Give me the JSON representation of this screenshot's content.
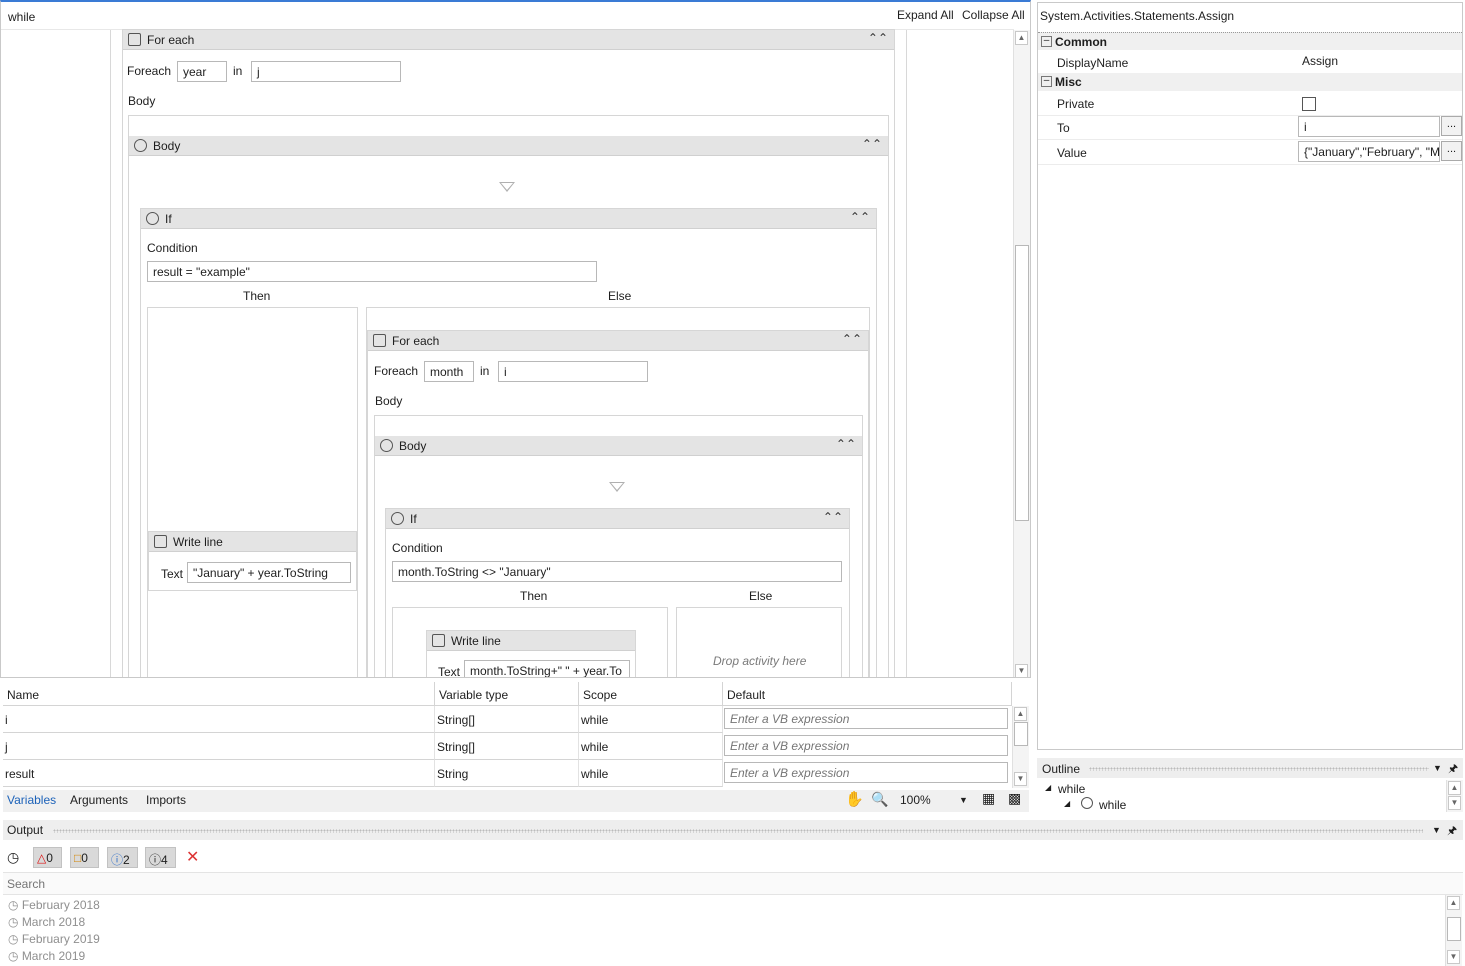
{
  "designer": {
    "breadcrumb": "while",
    "expand_all": "Expand All",
    "collapse_all": "Collapse All",
    "outer_foreach": {
      "title": "For each",
      "foreach_label": "Foreach",
      "item": "year",
      "in_label": "in",
      "collection": "j",
      "body_label": "Body"
    },
    "outer_body": {
      "title": "Body"
    },
    "outer_if": {
      "title": "If",
      "condition_label": "Condition",
      "condition": "result = \"example\"",
      "then_label": "Then",
      "else_label": "Else"
    },
    "writeline1": {
      "title": "Write line",
      "text_label": "Text",
      "text": "\"January\" + year.ToString"
    },
    "inner_foreach": {
      "title": "For each",
      "foreach_label": "Foreach",
      "item": "month",
      "in_label": "in",
      "collection": "i",
      "body_label": "Body"
    },
    "inner_body": {
      "title": "Body"
    },
    "inner_if": {
      "title": "If",
      "condition_label": "Condition",
      "condition": "month.ToString <> \"January\"",
      "then_label": "Then",
      "else_label": "Else",
      "drop_hint": "Drop activity here"
    },
    "writeline2": {
      "title": "Write line",
      "text_label": "Text",
      "text": "month.ToString+\" \" + year.To"
    }
  },
  "variables": {
    "headers": {
      "name": "Name",
      "type": "Variable type",
      "scope": "Scope",
      "default": "Default"
    },
    "rows": [
      {
        "name": "i",
        "type": "String[]",
        "scope": "while",
        "default_placeholder": "Enter a VB expression"
      },
      {
        "name": "j",
        "type": "String[]",
        "scope": "while",
        "default_placeholder": "Enter a VB expression"
      },
      {
        "name": "result",
        "type": "String",
        "scope": "while",
        "default_placeholder": "Enter a VB expression"
      }
    ]
  },
  "bottom_tabs": {
    "variables": "Variables",
    "arguments": "Arguments",
    "imports": "Imports",
    "zoom": "100%"
  },
  "properties": {
    "title": "System.Activities.Statements.Assign",
    "common": "Common",
    "display_name_label": "DisplayName",
    "display_name_value": "Assign",
    "misc": "Misc",
    "private_label": "Private",
    "to_label": "To",
    "to_value": "i",
    "value_label": "Value",
    "value_value": "{\"January\",\"February\", \"March\"}",
    "ellipsis": "..."
  },
  "outline": {
    "title": "Outline",
    "root": "while",
    "child": "while"
  },
  "output": {
    "title": "Output",
    "errors": "0",
    "warnings": "0",
    "info": "2",
    "trace": "4",
    "search_placeholder": "Search",
    "lines": [
      "February 2018",
      "March 2018",
      "February 2019",
      "March 2019"
    ]
  }
}
